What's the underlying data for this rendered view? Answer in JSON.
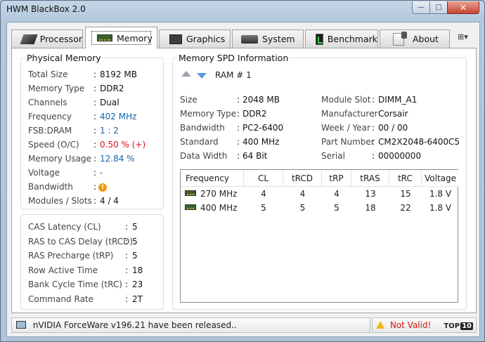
{
  "window": {
    "title": "HWM BlackBox 2.0",
    "controls": {
      "minimize": "—",
      "maximize": "□",
      "close": "✕"
    }
  },
  "tabs": [
    {
      "label": "Processor",
      "icon": "cpu-icon"
    },
    {
      "label": "Memory",
      "icon": "memory-icon"
    },
    {
      "label": "Graphics",
      "icon": "graphics-chip-icon"
    },
    {
      "label": "System",
      "icon": "system-icon"
    },
    {
      "label": "Benchmark",
      "icon": "benchmark-icon"
    },
    {
      "label": "About",
      "icon": "about-icon"
    }
  ],
  "tab_menu": "⊞▾",
  "physical_memory": {
    "title": "Physical Memory",
    "rows": [
      {
        "label": "Total Size",
        "value": "8192 MB",
        "color": "#111111"
      },
      {
        "label": "Memory Type",
        "value": "DDR2",
        "color": "#111111"
      },
      {
        "label": "Channels",
        "value": "Dual",
        "color": "#111111"
      },
      {
        "label": "Frequency",
        "value": "402 MHz",
        "color": "#1464b4"
      },
      {
        "label": "FSB:DRAM",
        "value": "1 : 2",
        "color": "#1464b4"
      },
      {
        "label": "Speed (O/C)",
        "value": "0.50 % (+)",
        "color": "#d31414"
      },
      {
        "label": "Memory Usage",
        "value": "12.84 %",
        "color": "#1464b4"
      },
      {
        "label": "Voltage",
        "value": "-",
        "color": "#1464b4"
      },
      {
        "label": "Bandwidth",
        "value": "!",
        "color": "#f29a0e"
      },
      {
        "label": "Modules / Slots",
        "value": "4  /  4",
        "color": "#111111"
      }
    ]
  },
  "timings": {
    "rows": [
      {
        "label": "CAS Latency (CL)",
        "value": "5"
      },
      {
        "label": "RAS to CAS Delay (tRCD)",
        "value": "5"
      },
      {
        "label": "RAS Precharge (tRP)",
        "value": "5"
      },
      {
        "label": "Row Active Time",
        "value": "18"
      },
      {
        "label": "Bank Cycle Time (tRC)",
        "value": "23"
      },
      {
        "label": "Command Rate",
        "value": "2T"
      }
    ]
  },
  "spd": {
    "title": "Memory SPD Information",
    "slot_label": "RAM # 1",
    "left": [
      {
        "label": "Size",
        "value": "2048 MB"
      },
      {
        "label": "Memory Type",
        "value": "DDR2"
      },
      {
        "label": "Bandwidth",
        "value": "PC2-6400"
      },
      {
        "label": "Standard",
        "value": "400 MHz"
      },
      {
        "label": "Data Width",
        "value": "64 Bit"
      }
    ],
    "right": [
      {
        "label": "Module Slot",
        "value": "DIMM_A1"
      },
      {
        "label": "Manufacturer",
        "value": "Corsair"
      },
      {
        "label": "Week / Year",
        "value": "00 / 00"
      },
      {
        "label": "Part Number",
        "value": "CM2X2048-6400C5"
      },
      {
        "label": "Serial",
        "value": "00000000"
      }
    ],
    "table": {
      "columns": [
        "Frequency",
        "CL",
        "tRCD",
        "tRP",
        "tRAS",
        "tRC",
        "Voltage"
      ],
      "rows": [
        [
          "270 MHz",
          "4",
          "4",
          "4",
          "13",
          "15",
          "1.8 V"
        ],
        [
          "400 MHz",
          "5",
          "5",
          "5",
          "18",
          "22",
          "1.8 V"
        ]
      ]
    }
  },
  "status": {
    "message": "nVIDIA ForceWare v196.21 have been released..",
    "validity": "Not Valid!",
    "badge_a": "TOP",
    "badge_b": "10"
  },
  "colors": {
    "valid_red": "#d31414",
    "accent_blue": "#1464b4",
    "warning_orange": "#f29a0e"
  }
}
